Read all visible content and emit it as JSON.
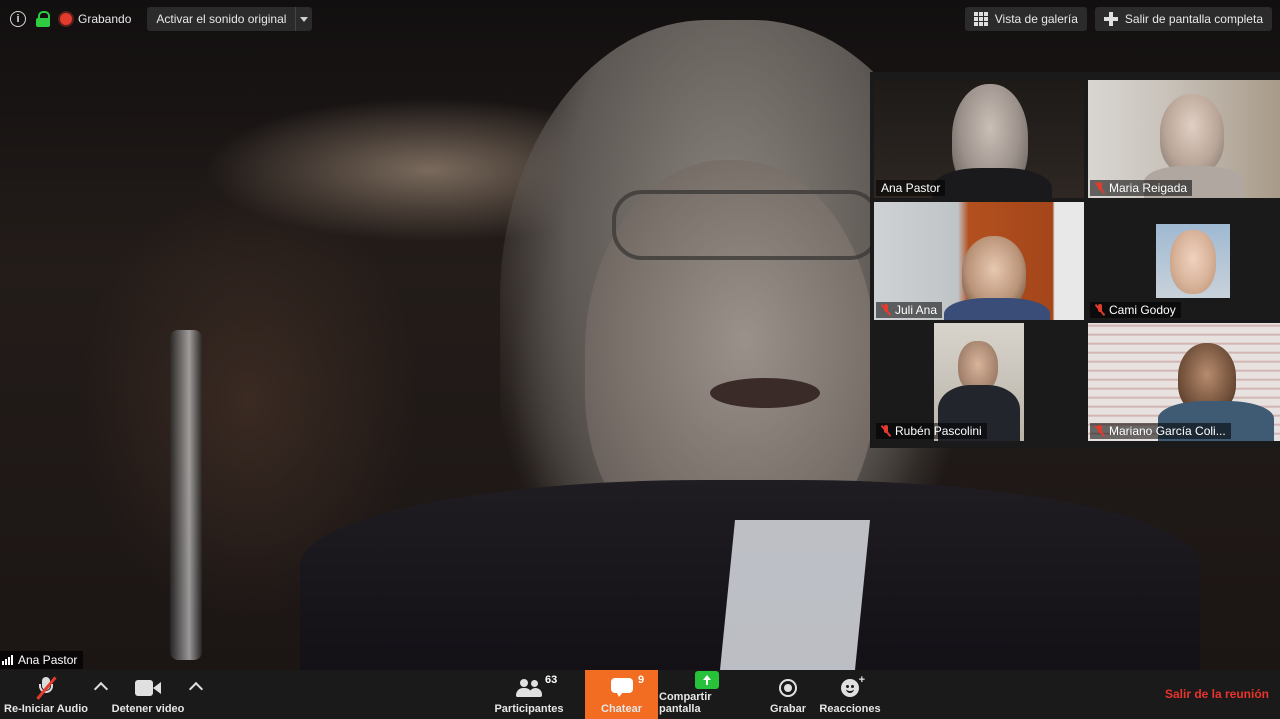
{
  "topbar": {
    "recording_label": "Grabando",
    "original_sound_label": "Activar el sonido original",
    "gallery_view_label": "Vista de galería",
    "exit_fullscreen_label": "Salir de pantalla completa"
  },
  "main_speaker": {
    "name": "Ana Pastor"
  },
  "gallery": {
    "tiles": [
      {
        "name": "Ana Pastor",
        "muted": false,
        "active": true
      },
      {
        "name": "Maria Reigada",
        "muted": true,
        "active": false
      },
      {
        "name": "Juli Ana",
        "muted": true,
        "active": false
      },
      {
        "name": "Cami Godoy",
        "muted": true,
        "active": false
      },
      {
        "name": "Rubén Pascolini",
        "muted": true,
        "active": false
      },
      {
        "name": "Mariano García Coli...",
        "muted": true,
        "active": false
      }
    ]
  },
  "toolbar": {
    "audio_label": "Re-Iniciar Audio",
    "video_label": "Detener video",
    "participants_label": "Participantes",
    "participants_count": "63",
    "chat_label": "Chatear",
    "chat_count": "9",
    "share_label": "Compartir pantalla",
    "record_label": "Grabar",
    "reactions_label": "Reacciones",
    "leave_label": "Salir de la reunión"
  },
  "colors": {
    "accent_orange": "#f26d21",
    "recording_red": "#e33b2e",
    "leave_red": "#e8342c",
    "share_green": "#27c13a",
    "active_speaker_border": "#d8d65a"
  }
}
